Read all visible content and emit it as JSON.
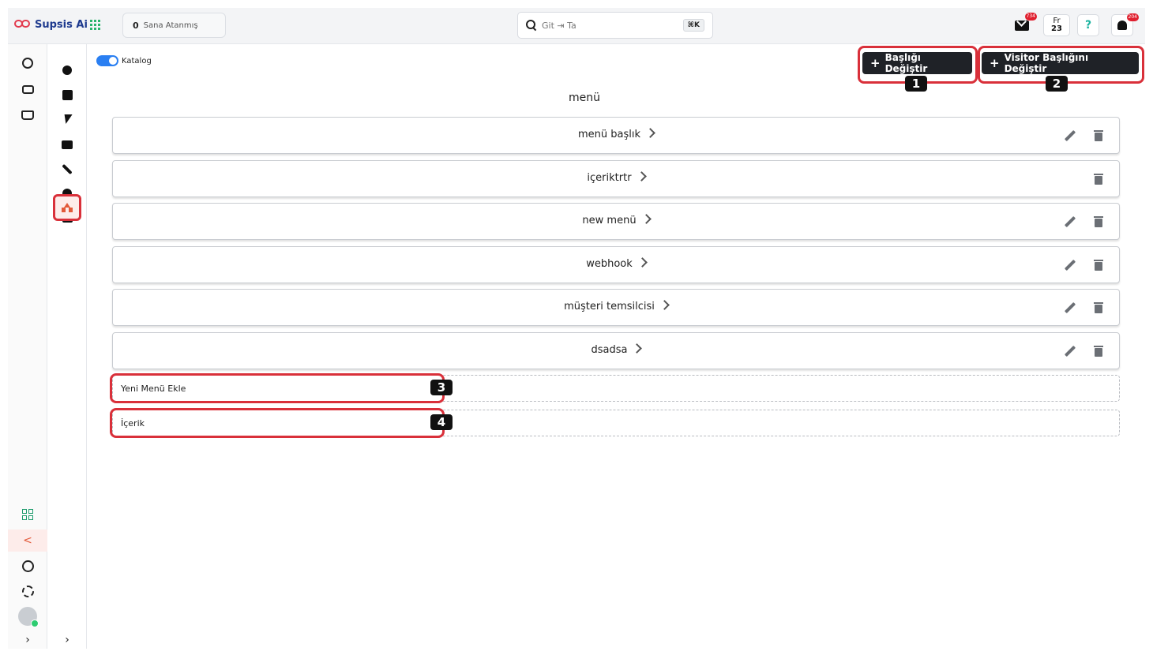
{
  "topbar": {
    "brand": "Supsis Ai",
    "assigned_count": "0",
    "assigned_label": "Sana Atanmış",
    "search_value": "Git ⇥ Ta",
    "search_shortcut": "⌘K",
    "mail_badge": "734",
    "calendar_day_abbr": "Fr",
    "calendar_day_num": "23",
    "help_glyph": "?",
    "bell_badge": "204"
  },
  "sidebar": {
    "main_icons": [
      "whatsapp-icon",
      "contact-card-icon",
      "inbox-icon"
    ],
    "sub_icons": [
      "gear-icon",
      "checkbox-icon",
      "bolt-icon",
      "chat-icon",
      "wrench-icon",
      "gear-icon",
      "message-icon",
      "shapes-icon"
    ],
    "bottom_icons": [
      "apps-icon",
      "share-icon",
      "clock-icon",
      "settings-icon",
      "avatar"
    ],
    "expand_glyph": "›"
  },
  "main": {
    "catalog_label": "Katalog",
    "btn_change_title": "Başlığı Değiştir",
    "btn_change_visitor_title": "Visitor Başlığını Değiştir",
    "title": "menü",
    "menu_items": [
      {
        "label": "menü başlık",
        "editable": true
      },
      {
        "label": "içeriktrtr",
        "editable": false
      },
      {
        "label": "new menü",
        "editable": true
      },
      {
        "label": "webhook",
        "editable": true
      },
      {
        "label": "müşteri temsilcisi",
        "editable": true
      },
      {
        "label": "dsadsa",
        "editable": true
      }
    ],
    "new_menu_input": "Yeni Menü Ekle",
    "content_input": "İçerik"
  },
  "annotations": [
    "1",
    "2",
    "3",
    "4"
  ],
  "colors": {
    "accent": "#d9303a",
    "brand": "#1f3b8f",
    "dark_button": "#1f2227",
    "toggle": "#2a7ff2"
  }
}
